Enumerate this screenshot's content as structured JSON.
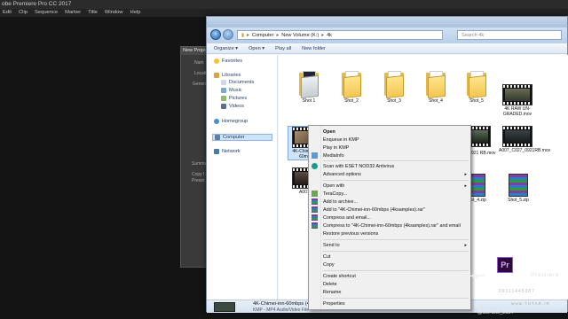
{
  "premiere": {
    "title": "obe Premiere Pro CC 2017",
    "menu": [
      "Edit",
      "Clip",
      "Sequence",
      "Marker",
      "Title",
      "Window",
      "Help"
    ],
    "dialog_title": "New Project",
    "dialog_labels": [
      "Nam",
      "Locatio",
      "General",
      "Summar",
      "Copy I",
      "Preset"
    ]
  },
  "explorer": {
    "address": [
      "Computer",
      "New Volume (K:)",
      "4k"
    ],
    "search_placeholder": "Search 4k",
    "toolbar": [
      "Organize ▾",
      "Open ▾",
      "Play all",
      "New folder"
    ],
    "nav": {
      "favorites": "Favorites",
      "libraries": "Libraries",
      "documents": "Documents",
      "music": "Music",
      "pictures": "Pictures",
      "videos": "Videos",
      "homegroup": "Homegroup",
      "computer": "Computer",
      "network": "Network"
    },
    "files_row1": [
      {
        "name": "Shot 1",
        "type": "folder"
      },
      {
        "name": "Shot_2",
        "type": "folder"
      },
      {
        "name": "Shot_3",
        "type": "folder"
      },
      {
        "name": "Shot_4",
        "type": "folder"
      },
      {
        "name": "Shot_5",
        "type": "folder"
      },
      {
        "name": "4K RAW UN-GRADED.mov",
        "type": "video"
      }
    ],
    "files_row2": [
      {
        "name": "4K-Chimei-inn-60mbps (4ksamples)",
        "type": "video"
      },
      {
        "name": "",
        "type": "video"
      },
      {
        "name": "",
        "type": "video"
      },
      {
        "name": "",
        "type": "video"
      },
      {
        "name": "C026_0921 RB.mov",
        "type": "video"
      },
      {
        "name": "A007_C027_0921RB.mov",
        "type": "video"
      }
    ],
    "files_row3": [
      {
        "name": "A007_C",
        "type": "video"
      },
      {
        "name": "Shot_4.zip",
        "type": "archive"
      },
      {
        "name": "Shot_5.zip",
        "type": "archive"
      }
    ],
    "details": {
      "name": "4K-Chimei-inn-60mbps (4ks",
      "type": "KMP - MP4 Audio/Video File"
    }
  },
  "context_menu": [
    {
      "label": "Open",
      "bold": true
    },
    {
      "label": "Enqueue in KMP"
    },
    {
      "label": "Play in KMP"
    },
    {
      "label": "MediaInfo",
      "icon": "mediainfo-icon"
    },
    {
      "label": "Scan with ESET NOD32 Antivirus",
      "icon": "eset-icon"
    },
    {
      "label": "Advanced options",
      "submenu": true
    },
    {
      "label": "Open with",
      "submenu": true
    },
    {
      "label": "TeraCopy...",
      "icon": "teracopy-icon"
    },
    {
      "label": "Add to archive...",
      "icon": "winrar-icon"
    },
    {
      "label": "Add to \"4K-Chimei-inn-60mbps (4ksamples).rar\"",
      "icon": "winrar-icon"
    },
    {
      "label": "Compress and email...",
      "icon": "winrar-icon"
    },
    {
      "label": "Compress to \"4K-Chimei-inn-60mbps (4ksamples).rar\" and email",
      "icon": "winrar-icon"
    },
    {
      "label": "Restore previous versions"
    },
    {
      "label": "Send to",
      "submenu": true
    },
    {
      "label": "Cut"
    },
    {
      "label": "Copy"
    },
    {
      "label": "Create shortcut"
    },
    {
      "label": "Delete"
    },
    {
      "label": "Rename"
    },
    {
      "label": "Properties"
    }
  ],
  "watermark": {
    "logo": "Pr",
    "brand": "Premiere",
    "arabic": "سهیل شریفی",
    "phone": "09111445387",
    "web": "www.TUTAR.IR",
    "handle": "@SOHEIL_2034"
  }
}
